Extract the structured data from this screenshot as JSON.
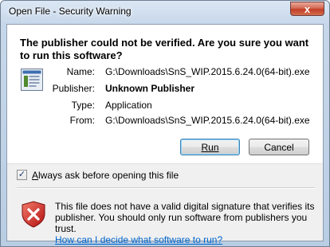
{
  "window": {
    "title": "Open File - Security Warning",
    "close_label": "x"
  },
  "dialog": {
    "headline": "The publisher could not be verified.  Are you sure you want to run this software?",
    "app_icon": "application-icon",
    "fields": [
      {
        "label": "Name:",
        "value": "G:\\Downloads\\SnS_WIP.2015.6.24.0(64-bit).exe"
      },
      {
        "label": "Publisher:",
        "value": "Unknown Publisher"
      },
      {
        "label": "Type:",
        "value": "Application"
      },
      {
        "label": "From:",
        "value": "G:\\Downloads\\SnS_WIP.2015.6.24.0(64-bit).exe"
      }
    ],
    "buttons": {
      "run": "Run",
      "cancel": "Cancel"
    }
  },
  "checkbox": {
    "checked": true,
    "label_accesskey": "A",
    "label_rest": "lways ask before opening this file"
  },
  "warning": {
    "icon": "shield-error-icon",
    "text": "This file does not have a valid digital signature that verifies its publisher.  You should only run software from publishers you trust.",
    "link": "How can I decide what software to run?"
  }
}
